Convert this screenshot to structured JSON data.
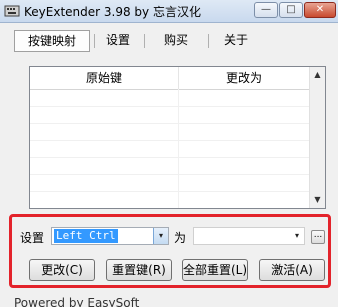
{
  "window": {
    "title": "KeyExtender 3.98 by 忘言汉化",
    "buttons": {
      "minimize": "—",
      "maximize": "□",
      "close": "✕"
    }
  },
  "tabs": [
    {
      "label": "按键映射",
      "active": true
    },
    {
      "label": "设置",
      "active": false
    },
    {
      "label": "购买",
      "active": false
    },
    {
      "label": "关于",
      "active": false
    }
  ],
  "table": {
    "columns": [
      "原始键",
      "更改为"
    ],
    "rows": []
  },
  "settings": {
    "label": "设置",
    "source_key": "Left Ctrl",
    "to_label": "为",
    "target_key": "",
    "browse_label": "..."
  },
  "buttons": {
    "change": "更改(C)",
    "reset_key": "重置键(R)",
    "reset_all": "全部重置(L)",
    "activate": "激活(A)"
  },
  "status": "Powered by EasySoft",
  "icons": {
    "dropdown": "▾",
    "scroll_up": "▲",
    "scroll_down": "▼"
  },
  "colors": {
    "highlight_border": "#e3232b",
    "selection": "#3399ff"
  }
}
